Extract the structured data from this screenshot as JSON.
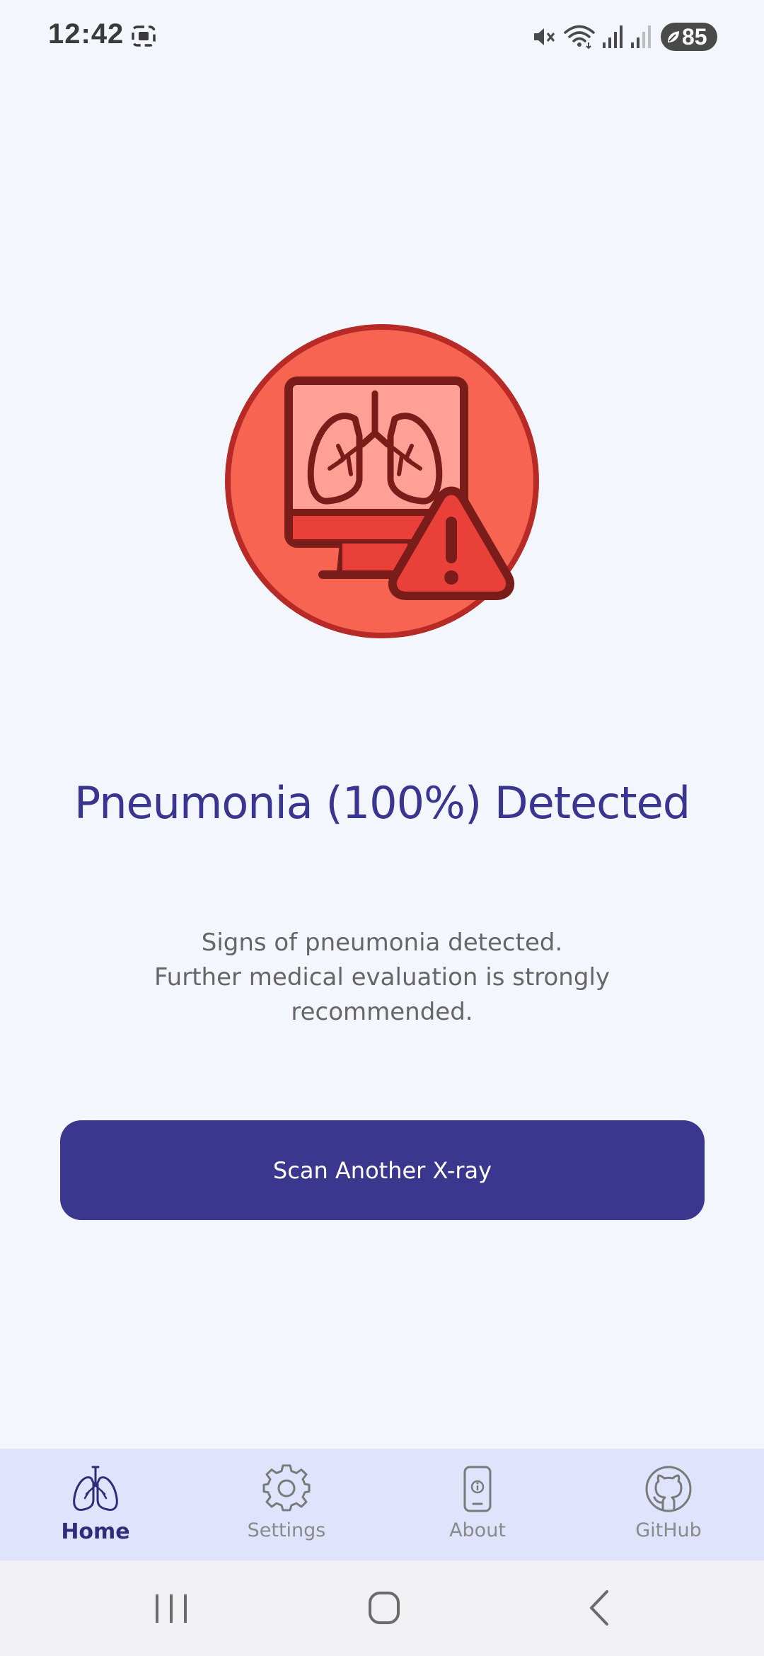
{
  "status_bar": {
    "time": "12:42",
    "battery_level": "85",
    "icons": [
      "screenshot-icon",
      "mute-icon",
      "wifi-icon",
      "signal-icon",
      "signal-icon",
      "battery-icon"
    ]
  },
  "result": {
    "illustration_icon": "lung-monitor-warning-icon",
    "title": "Pneumonia (100%) Detected",
    "message_line1": "Signs of pneumonia detected.",
    "message_line2": "Further medical evaluation is strongly",
    "message_line3": "recommended."
  },
  "actions": {
    "scan_another_label": "Scan Another X-ray"
  },
  "bottom_nav": {
    "items": [
      {
        "label": "Home",
        "icon": "lungs-icon",
        "active": true
      },
      {
        "label": "Settings",
        "icon": "gear-icon",
        "active": false
      },
      {
        "label": "About",
        "icon": "phone-info-icon",
        "active": false
      },
      {
        "label": "GitHub",
        "icon": "github-icon",
        "active": false
      }
    ]
  },
  "system_nav": {
    "buttons": [
      "recents-icon",
      "home-circle-icon",
      "back-icon"
    ]
  },
  "colors": {
    "background": "#f4f6fe",
    "accent": "#3b378e",
    "title": "#3a3590",
    "alert_red": "#e9413a",
    "nav_background": "#dfe3fb"
  }
}
